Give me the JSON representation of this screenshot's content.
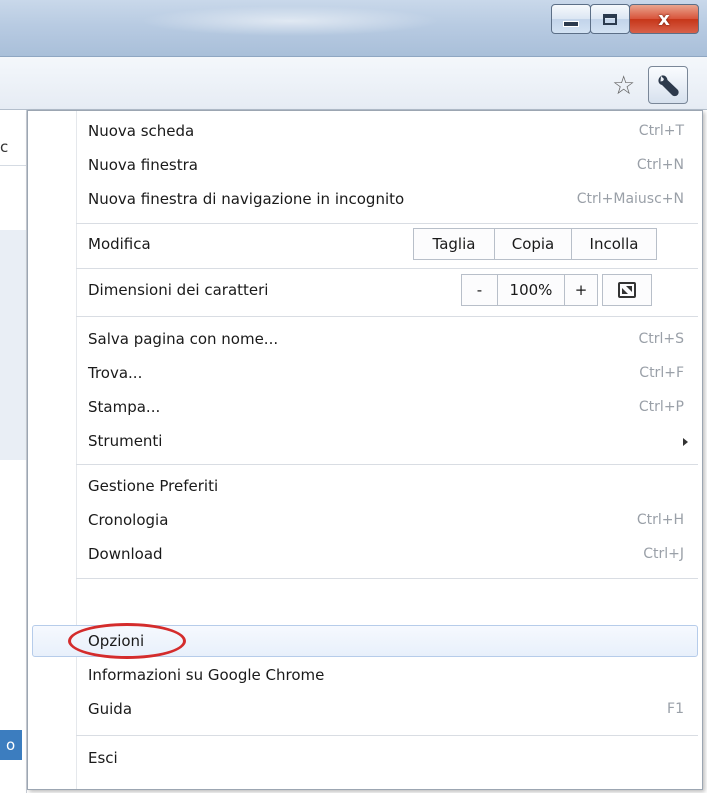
{
  "window": {
    "close_label": "x"
  },
  "menu": {
    "group1": [
      {
        "label": "Nuova scheda",
        "shortcut": "Ctrl+T"
      },
      {
        "label": "Nuova finestra",
        "shortcut": "Ctrl+N"
      },
      {
        "label": "Nuova finestra di navigazione in incognito",
        "shortcut": "Ctrl+Maiusc+N"
      }
    ],
    "edit": {
      "label": "Modifica",
      "cut": "Taglia",
      "copy": "Copia",
      "paste": "Incolla"
    },
    "zoom": {
      "label": "Dimensioni dei caratteri",
      "minus": "-",
      "value": "100%",
      "plus": "+"
    },
    "group3": [
      {
        "label": "Salva pagina con nome...",
        "shortcut": "Ctrl+S"
      },
      {
        "label": "Trova...",
        "shortcut": "Ctrl+F"
      },
      {
        "label": "Stampa...",
        "shortcut": "Ctrl+P"
      },
      {
        "label": "Strumenti",
        "shortcut": ""
      }
    ],
    "group4": [
      {
        "label": "Gestione Preferiti",
        "shortcut": ""
      },
      {
        "label": "Cronologia",
        "shortcut": "Ctrl+H"
      },
      {
        "label": "Download",
        "shortcut": "Ctrl+J"
      }
    ],
    "group5": [
      {
        "label": "Opzioni",
        "shortcut": ""
      },
      {
        "label": "Informazioni su Google Chrome",
        "shortcut": ""
      },
      {
        "label": "Guida",
        "shortcut": "F1"
      }
    ],
    "exit": {
      "label": "Esci"
    }
  },
  "background": {
    "left_char": "c",
    "bottom_char": "o"
  },
  "colors": {
    "highlight_oval": "#d42c2c",
    "selected_row": "#e8f0fb"
  },
  "icons": {
    "star": "bookmark-star-icon",
    "wrench": "wrench-icon",
    "fullscreen": "fullscreen-icon",
    "submenu": "submenu-arrow-icon"
  }
}
